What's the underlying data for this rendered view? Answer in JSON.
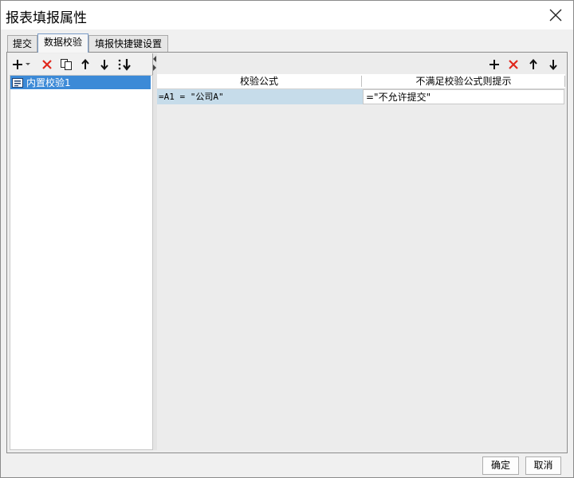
{
  "window": {
    "title": "报表填报属性"
  },
  "tabs": [
    {
      "label": "提交"
    },
    {
      "label": "数据校验"
    },
    {
      "label": "填报快捷键设置"
    }
  ],
  "left_toolbar": {
    "icons": [
      "add-icon",
      "dropdown-arrow-icon",
      "delete-icon",
      "copy-icon",
      "move-up-icon",
      "move-down-icon",
      "move-bottom-icon"
    ]
  },
  "list": {
    "items": [
      {
        "label": "内置校验1",
        "selected": true
      }
    ]
  },
  "right_toolbar": {
    "icons": [
      "add-icon",
      "delete-icon",
      "move-up-icon",
      "move-down-icon"
    ]
  },
  "table": {
    "columns": [
      "校验公式",
      "不满足校验公式则提示"
    ],
    "rows": [
      {
        "formula": "=A1 = \"公司A\"",
        "message": "=\"不允许提交\""
      }
    ]
  },
  "footer": {
    "ok_label": "确定",
    "cancel_label": "取消"
  },
  "colors": {
    "selection": "#3c8ad7",
    "row_highlight": "#c6dcea",
    "delete_red": "#e0261b"
  }
}
